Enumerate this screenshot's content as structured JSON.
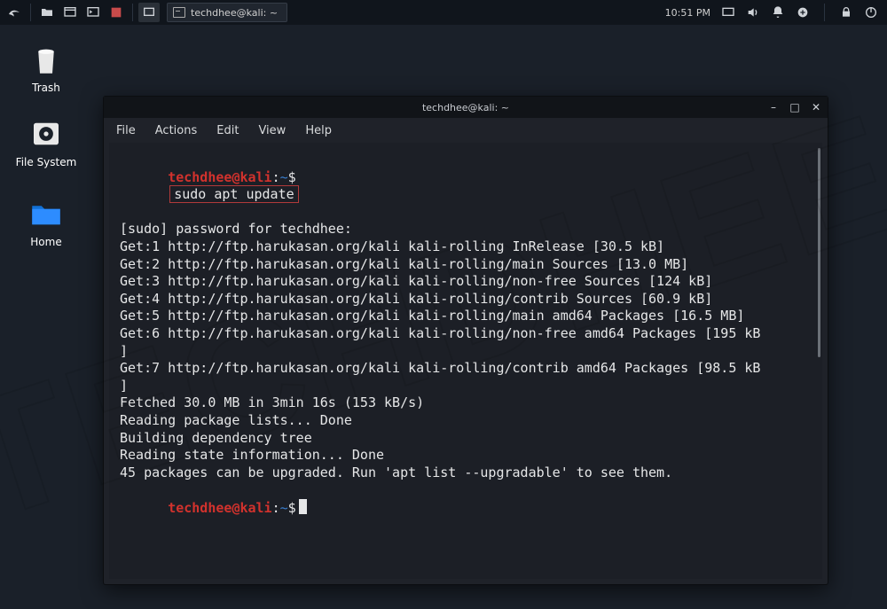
{
  "taskbar": {
    "task_button_label": "techdhee@kali: ~",
    "clock": "10:51 PM"
  },
  "desktop": {
    "trash": "Trash",
    "filesystem": "File System",
    "home": "Home"
  },
  "window": {
    "title": "techdhee@kali: ~",
    "menu": {
      "file": "File",
      "actions": "Actions",
      "edit": "Edit",
      "view": "View",
      "help": "Help"
    },
    "controls": {
      "min": "–",
      "max": "□",
      "close": "✕"
    }
  },
  "prompt": {
    "user": "techdhee",
    "at": "@",
    "host": "kali",
    "colon": ":",
    "path": "~",
    "dollar": "$"
  },
  "terminal": {
    "cmd1": "sudo apt update",
    "l0": "[sudo] password for techdhee:",
    "l1": "Get:1 http://ftp.harukasan.org/kali kali-rolling InRelease [30.5 kB]",
    "l2": "Get:2 http://ftp.harukasan.org/kali kali-rolling/main Sources [13.0 MB]",
    "l3": "Get:3 http://ftp.harukasan.org/kali kali-rolling/non-free Sources [124 kB]",
    "l4": "Get:4 http://ftp.harukasan.org/kali kali-rolling/contrib Sources [60.9 kB]",
    "l5": "Get:5 http://ftp.harukasan.org/kali kali-rolling/main amd64 Packages [16.5 MB]",
    "l6a": "Get:6 http://ftp.harukasan.org/kali kali-rolling/non-free amd64 Packages [195 kB",
    "l6b": "]",
    "l7a": "Get:7 http://ftp.harukasan.org/kali kali-rolling/contrib amd64 Packages [98.5 kB",
    "l7b": "]",
    "l8": "Fetched 30.0 MB in 3min 16s (153 kB/s)",
    "l9": "Reading package lists... Done",
    "l10": "Building dependency tree",
    "l11": "Reading state information... Done",
    "l12": "45 packages can be upgraded. Run 'apt list --upgradable' to see them."
  },
  "watermark": "TECHDHEE"
}
